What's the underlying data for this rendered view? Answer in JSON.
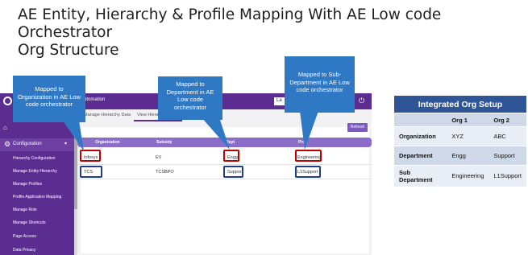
{
  "slide": {
    "title_line1": "AE Entity, Hierarchy & Profile Mapping With AE Low code Orchestrator",
    "title_line2": "Org Structure"
  },
  "app": {
    "title": "utomation",
    "language": "La",
    "tabs": [
      "Manage Hierarchy Data",
      "View Hiera"
    ],
    "refresh_label": "Refresh",
    "sidebar": {
      "home_icon": "home-icon",
      "config_label": "Configuration",
      "items": [
        "Hierarchy Configuration",
        "Manage Entity Hierarchy",
        "Manage Profiles",
        "Profile Application Mapping",
        "Manage Role",
        "Manage Shortcuts",
        "Page Access",
        "Data Privacy"
      ]
    },
    "table": {
      "headers": [
        "Organization",
        "Subsidy",
        "Dept",
        "Pro"
      ],
      "rows": [
        [
          "Infosys",
          "EV",
          "Engg",
          "Engineering"
        ],
        [
          "TCS",
          "TCSBPO",
          "Support",
          "L1Support"
        ]
      ]
    }
  },
  "callouts": {
    "org": [
      "Mapped to",
      "Organization in AE Low",
      "code orchestrator"
    ],
    "dept": [
      "Mapped to",
      "Department in AE",
      "Low code",
      "orchestrator"
    ],
    "subdept": [
      "Mapped to Sub-",
      "Department in AE Low",
      "code orchestrator"
    ]
  },
  "org_setup": {
    "title": "Integrated Org Setup",
    "headers": [
      "",
      "Org 1",
      "Org 2"
    ],
    "rows": [
      {
        "label": "Organization",
        "org1": "XYZ",
        "org2": "ABC"
      },
      {
        "label": "Department",
        "org1": "Engg",
        "org2": "Support"
      },
      {
        "label": "Sub Department",
        "org1": "Engineering",
        "org2": "L1Support"
      }
    ]
  },
  "colors": {
    "brand_purple": "#5b2d91",
    "callout_blue": "#2f78c4",
    "highlight_red": "#c00000",
    "highlight_blue": "#1f3f8c",
    "table_header": "#2e5596"
  }
}
